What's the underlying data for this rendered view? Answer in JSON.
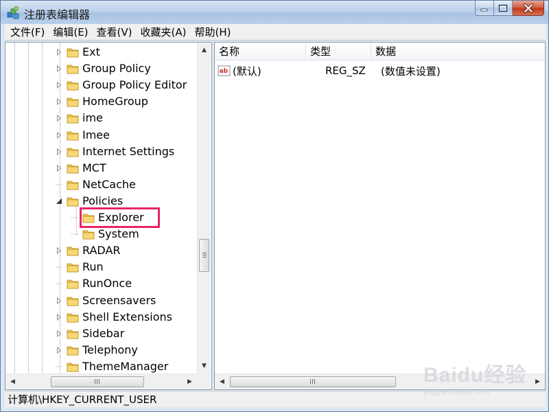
{
  "window": {
    "title": "注册表编辑器"
  },
  "menu": [
    "文件(F)",
    "编辑(E)",
    "查看(V)",
    "收藏夹(A)",
    "帮助(H)"
  ],
  "tree": {
    "items": [
      {
        "label": "Ext",
        "expander": "collapsed",
        "level": 0
      },
      {
        "label": "Group Policy",
        "expander": "collapsed",
        "level": 0
      },
      {
        "label": "Group Policy Editor",
        "expander": "collapsed",
        "level": 0
      },
      {
        "label": "HomeGroup",
        "expander": "collapsed",
        "level": 0
      },
      {
        "label": "ime",
        "expander": "collapsed",
        "level": 0
      },
      {
        "label": "Imee",
        "expander": "collapsed",
        "level": 0
      },
      {
        "label": "Internet Settings",
        "expander": "collapsed",
        "level": 0
      },
      {
        "label": "MCT",
        "expander": "collapsed",
        "level": 0
      },
      {
        "label": "NetCache",
        "expander": "none",
        "level": 0
      },
      {
        "label": "Policies",
        "expander": "expanded",
        "level": 0
      },
      {
        "label": "Explorer",
        "expander": "none",
        "level": 1,
        "highlighted": true
      },
      {
        "label": "System",
        "expander": "none",
        "level": 1
      },
      {
        "label": "RADAR",
        "expander": "collapsed",
        "level": 0
      },
      {
        "label": "Run",
        "expander": "none",
        "level": 0
      },
      {
        "label": "RunOnce",
        "expander": "none",
        "level": 0
      },
      {
        "label": "Screensavers",
        "expander": "collapsed",
        "level": 0
      },
      {
        "label": "Shell Extensions",
        "expander": "collapsed",
        "level": 0
      },
      {
        "label": "Sidebar",
        "expander": "collapsed",
        "level": 0
      },
      {
        "label": "Telephony",
        "expander": "collapsed",
        "level": 0
      },
      {
        "label": "ThemeManager",
        "expander": "none",
        "level": 0
      }
    ]
  },
  "list": {
    "columns": [
      "名称",
      "类型",
      "数据"
    ],
    "rows": [
      {
        "name": "(默认)",
        "type": "REG_SZ",
        "data": "(数值未设置)",
        "icon": "string-value-icon"
      }
    ]
  },
  "statusbar": {
    "path": "计算机\\HKEY_CURRENT_USER"
  },
  "watermark": {
    "brand": "Baidu经验",
    "url": "jingyan.baidu.com"
  },
  "colors": {
    "highlight": "#e8236a",
    "folder": "#f2c14e"
  }
}
